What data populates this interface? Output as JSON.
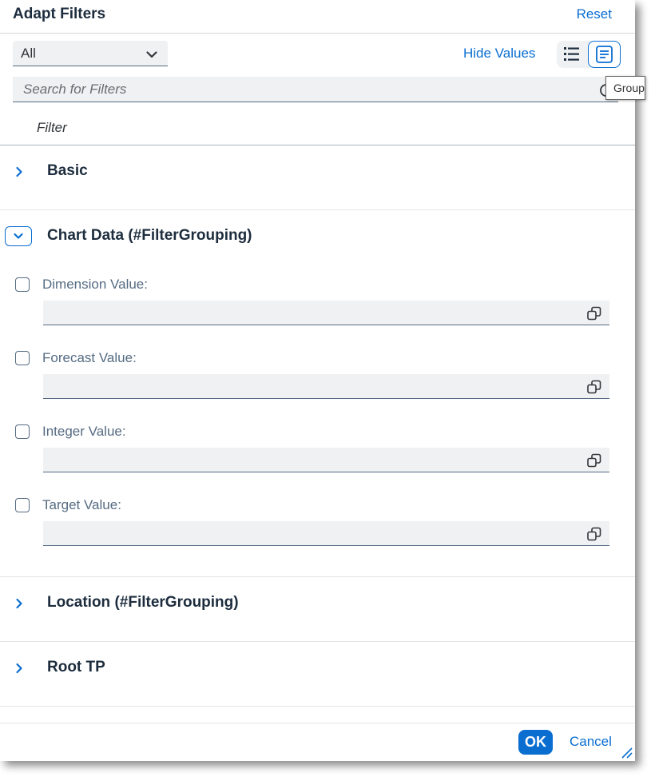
{
  "dialog": {
    "title": "Adapt Filters",
    "reset_label": "Reset"
  },
  "toolbar": {
    "select_value": "All",
    "hide_values_label": "Hide Values",
    "search_placeholder": "Search for Filters",
    "tooltip_text": "Group"
  },
  "table": {
    "column_header": "Filter"
  },
  "groups": [
    {
      "title": "Basic",
      "expanded": false
    },
    {
      "title": "Chart Data (#FilterGrouping)",
      "expanded": true
    },
    {
      "title": "Location (#FilterGrouping)",
      "expanded": false
    },
    {
      "title": "Root TP",
      "expanded": false
    }
  ],
  "fields": [
    {
      "label": "Dimension Value:",
      "checked": false,
      "value": ""
    },
    {
      "label": "Forecast Value:",
      "checked": false,
      "value": ""
    },
    {
      "label": "Integer Value:",
      "checked": false,
      "value": ""
    },
    {
      "label": "Target Value:",
      "checked": false,
      "value": ""
    }
  ],
  "footer": {
    "ok_label": "OK",
    "cancel_label": "Cancel"
  },
  "colors": {
    "accent": "#0a6ed1",
    "field_bg": "#eff1f2",
    "title_text": "#1d2d3e",
    "label_text": "#556b82"
  },
  "icons": {
    "select_chevron": "chevron-down-icon",
    "list_view": "list-icon",
    "group_view": "group-view-icon",
    "search": "search-icon",
    "collapsed": "chevron-right-icon",
    "expanded": "chevron-down-icon",
    "value_help": "value-help-icon",
    "resize": "resize-handle-icon"
  }
}
